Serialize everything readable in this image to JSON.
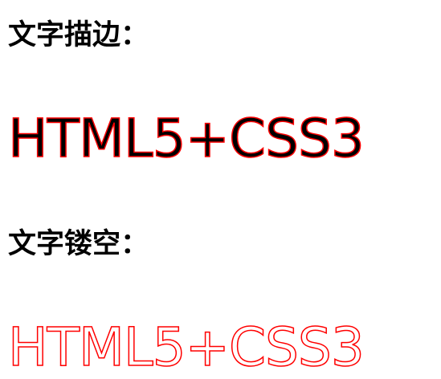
{
  "sections": [
    {
      "heading": "文字描边：",
      "sample_text": "HTML5+CSS3",
      "fill_color": "#000000",
      "stroke_color": "#ff0000"
    },
    {
      "heading": "文字镂空：",
      "sample_text": "HTML5+CSS3",
      "fill_color": "#ffffff",
      "stroke_color": "#ff0000"
    }
  ]
}
